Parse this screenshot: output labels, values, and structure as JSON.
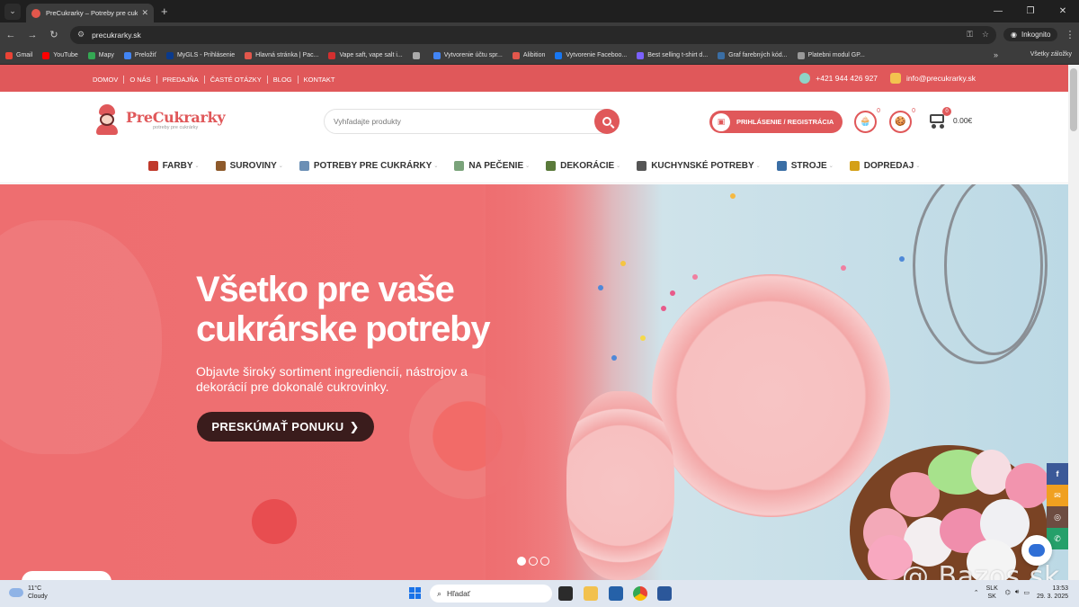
{
  "browser": {
    "tab_title": "PreCukrarky – Potreby pre cukrá",
    "url": "precukrarky.sk",
    "incognito_label": "Inkognito",
    "bookmarks": [
      {
        "label": "Gmail",
        "color": "#ea4335"
      },
      {
        "label": "YouTube",
        "color": "#ff0000"
      },
      {
        "label": "Mapy",
        "color": "#34a853"
      },
      {
        "label": "Preložiť",
        "color": "#4285f4"
      },
      {
        "label": "MyGLS - Prihlásenie",
        "color": "#0a3a8c"
      },
      {
        "label": "Hlavná stránka | Pac...",
        "color": "#e2574c"
      },
      {
        "label": "Vape saft, vape salt i...",
        "color": "#d32f2f"
      },
      {
        "label": "",
        "color": "#aaaaaa"
      },
      {
        "label": "Vytvorenie účtu spr...",
        "color": "#4285f4"
      },
      {
        "label": "Alibition",
        "color": "#e2574c"
      },
      {
        "label": "Vytvorenie Faceboo...",
        "color": "#1877f2"
      },
      {
        "label": "Best selling t-shirt d...",
        "color": "#7b61ff"
      },
      {
        "label": "Graf farebných kód...",
        "color": "#3a6ea5"
      },
      {
        "label": "Platebni modul GP...",
        "color": "#999999"
      }
    ],
    "all_bookmarks_label": "Všetky záložky"
  },
  "topbar": {
    "links": [
      "DOMOV",
      "O NÁS",
      "PREDAJŇA",
      "ČASTÉ OTÁZKY",
      "BLOG",
      "KONTAKT"
    ],
    "phone": "+421 944 426 927",
    "email": "info@precukrarky.sk"
  },
  "header": {
    "logo_name": "PreCukrarky",
    "logo_tagline": "potreby pre cukrárky",
    "search_placeholder": "Vyhľadajte produkty",
    "login_label": "PRIHLÁSENIE / REGISTRÁCIA",
    "wishlist_count": "0",
    "compare_count": "0",
    "cart_count": "0",
    "cart_total": "0.00€"
  },
  "categories": [
    {
      "label": "FARBY",
      "color": "#c0392b"
    },
    {
      "label": "SUROVINY",
      "color": "#8e5a2b"
    },
    {
      "label": "POTREBY PRE CUKRÁRKY",
      "color": "#6b8fb5"
    },
    {
      "label": "NA PEČENIE",
      "color": "#7aa37a"
    },
    {
      "label": "DEKORÁCIE",
      "color": "#5a7a3a"
    },
    {
      "label": "KUCHYNSKÉ POTREBY",
      "color": "#555555"
    },
    {
      "label": "STROJE",
      "color": "#3a6ea5"
    },
    {
      "label": "DOPREDAJ",
      "color": "#d4a017"
    }
  ],
  "hero": {
    "title": "Všetko pre vaše cukrárske potreby",
    "subtitle": "Objavte široký sortiment ingrediencií, nástrojov a dekorácií pre dokonalé cukrovinky.",
    "cta_label": "PRESKÚMAŤ PONUKU",
    "slides_total": 3,
    "active_slide": 1
  },
  "social": [
    {
      "name": "facebook",
      "glyph": "f",
      "color": "#3b5998"
    },
    {
      "name": "email",
      "glyph": "✉",
      "color": "#f0a020"
    },
    {
      "name": "instagram",
      "glyph": "◎",
      "color": "#6d4c41"
    },
    {
      "name": "whatsapp",
      "glyph": "✆",
      "color": "#25a06a"
    }
  ],
  "taskbar": {
    "temperature": "11°C",
    "weather": "Cloudy",
    "search_label": "Hľadať",
    "lang_top": "SLK",
    "lang_bottom": "SK",
    "time": "13:53",
    "date": "29. 3. 2025"
  },
  "watermark": "@ Bazos.sk"
}
